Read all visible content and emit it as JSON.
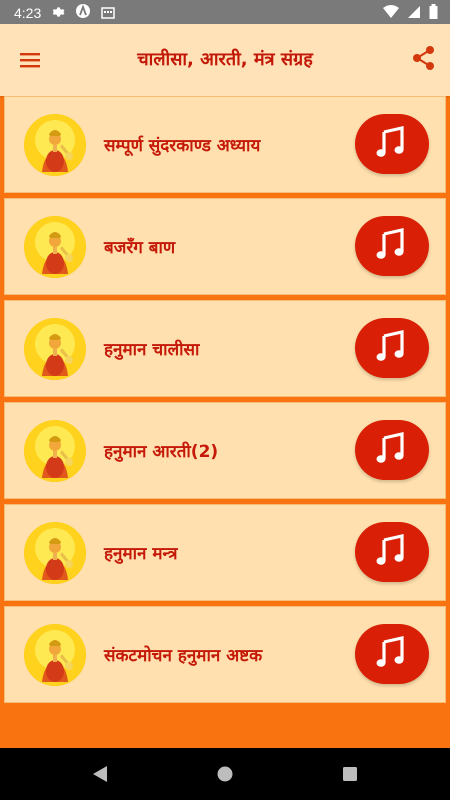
{
  "status_bar": {
    "time": "4:23",
    "icons": [
      "gear-icon",
      "app-logo-icon",
      "keyboard-icon",
      "wifi-icon",
      "signal-icon",
      "battery-icon"
    ]
  },
  "app_bar": {
    "title": "चालीसा, आरती, मंत्र संग्रह",
    "menu_icon": "hamburger-menu-icon",
    "share_icon": "share-icon"
  },
  "items": [
    {
      "label": "सम्पूर्ण सुंदरकाण्ड अध्याय"
    },
    {
      "label": "बजरँग बाण"
    },
    {
      "label": "हनुमान चालीसा"
    },
    {
      "label": "हनुमान आरती(2)"
    },
    {
      "label": "हनुमान मन्त्र"
    },
    {
      "label": "संकटमोचन हनुमान अष्टक"
    }
  ],
  "colors": {
    "accent": "#d91f05",
    "title": "#c21808",
    "item_background": "#ffe0ae",
    "footer": "#f97310"
  },
  "nav": [
    "back-icon",
    "home-icon",
    "recents-icon"
  ]
}
